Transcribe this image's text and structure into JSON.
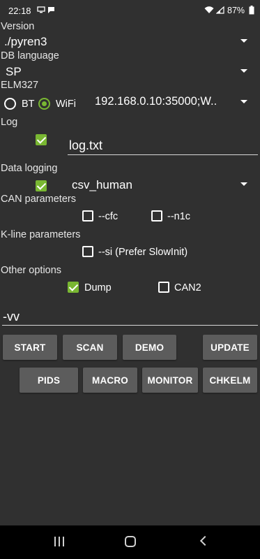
{
  "status_bar": {
    "time": "22:18",
    "battery": "87%",
    "icons": [
      "screen-icon",
      "chat-icon",
      "wifi-icon",
      "signal-icon",
      "battery-icon"
    ]
  },
  "version": {
    "label": "Version",
    "value": "./pyren3"
  },
  "db_language": {
    "label": "DB language",
    "value": "SP"
  },
  "elm327": {
    "label": "ELM327",
    "bt_label": "BT",
    "wifi_label": "WiFi",
    "selected": "WiFi",
    "address": "192.168.0.10:35000;W.."
  },
  "log": {
    "label": "Log",
    "checked": true,
    "filename": "log.txt"
  },
  "data_logging": {
    "label": "Data logging",
    "checked": true,
    "value": "csv_human"
  },
  "can_parameters": {
    "label": "CAN parameters",
    "cfc_label": "--cfc",
    "cfc_checked": false,
    "n1c_label": "--n1c",
    "n1c_checked": false
  },
  "kline_parameters": {
    "label": "K-line parameters",
    "si_label": "--si (Prefer SlowInit)",
    "si_checked": false
  },
  "other_options": {
    "label": "Other options",
    "dump_label": "Dump",
    "dump_checked": true,
    "can2_label": "CAN2",
    "can2_checked": false
  },
  "extra_args": {
    "value": "-vv"
  },
  "buttons": {
    "start": "START",
    "scan": "SCAN",
    "demo": "DEMO",
    "update": "UPDATE",
    "pids": "PIDS",
    "macro": "MACRO",
    "monitor": "MONITOR",
    "chkelm": "CHKELM"
  },
  "colors": {
    "background": "#303030",
    "accent": "#79b732",
    "button": "#5c5c5c",
    "navbar": "#000000"
  }
}
